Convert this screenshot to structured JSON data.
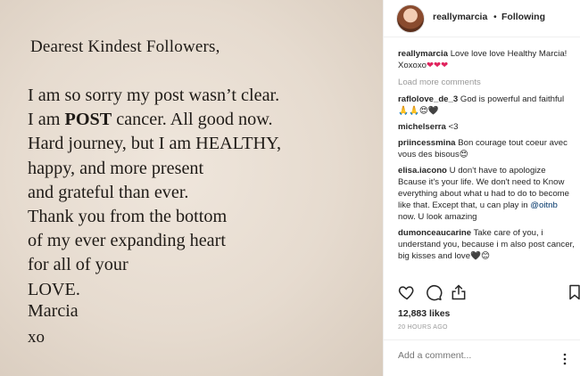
{
  "photo": {
    "greeting": "Dearest Kindest Followers,",
    "lines": [
      {
        "pre": "I am so sorry my post wasn’t clear.",
        "bold": "",
        "post": ""
      },
      {
        "pre": "I am ",
        "bold": "POST",
        "post": " cancer. All good now."
      },
      {
        "pre": "Hard journey, but I am HEALTHY,",
        "bold": "",
        "post": ""
      },
      {
        "pre": "happy, and more present",
        "bold": "",
        "post": ""
      },
      {
        "pre": "and grateful than ever.",
        "bold": "",
        "post": ""
      },
      {
        "pre": "Thank you from the bottom",
        "bold": "",
        "post": ""
      },
      {
        "pre": "of my ever expanding heart",
        "bold": "",
        "post": ""
      },
      {
        "pre": "for all of your",
        "bold": "",
        "post": ""
      },
      {
        "pre": "LOVE.",
        "bold": "",
        "post": ""
      }
    ],
    "signature": "Marcia",
    "signoff": "xo"
  },
  "header": {
    "username": "reallymarcia",
    "separator": "•",
    "follow_status": "Following"
  },
  "caption": {
    "username": "reallymarcia",
    "text": "Love love love Healthy Marcia!",
    "text2": "Xoxoxo",
    "emoji": "❤❤❤"
  },
  "load_more": "Load more comments",
  "comments": [
    {
      "user": "raflolove_de_3",
      "text": "God is powerful and faithful 🙏🙏😍🖤"
    },
    {
      "user": "michelserra",
      "text": "<3"
    },
    {
      "user": "priincessmina",
      "text": "Bon courage tout coeur avec vous des bisous😍"
    },
    {
      "user": "elisa.iacono",
      "text": "U don't have to apologize Bcause it's your life. We don't need to Know everything about what u had to do to become like that. Except that, u can play in ",
      "mention": "@oitnb",
      "text_after": " now. U look amazing"
    },
    {
      "user": "dumonceaucarine",
      "text": "Take care of you, i understand you, because i m also post cancer, big kisses and love🖤😊"
    }
  ],
  "likes": "12,883 likes",
  "time": "20 HOURS AGO",
  "add_comment_placeholder": "Add a comment..."
}
